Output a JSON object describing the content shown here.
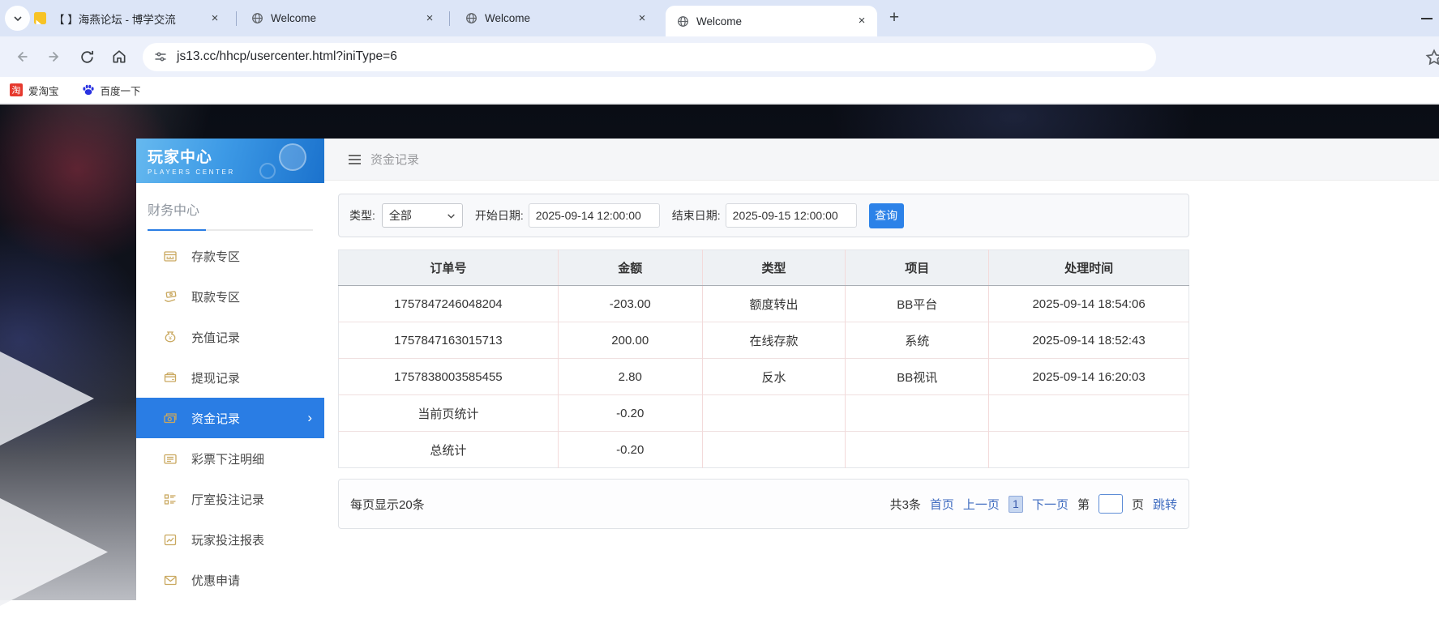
{
  "browser": {
    "tabs": [
      {
        "title": "【 】海燕论坛 - 博学交流",
        "icon": "note-icon",
        "active": false
      },
      {
        "title": "Welcome",
        "icon": "globe-icon",
        "active": false
      },
      {
        "title": "Welcome",
        "icon": "globe-icon",
        "active": false
      },
      {
        "title": "Welcome",
        "icon": "globe-icon",
        "active": true
      }
    ],
    "new_tab_label": "+",
    "url": "js13.cc/hhcp/usercenter.html?iniType=6",
    "nav_icons": [
      "back-icon",
      "forward-icon",
      "reload-icon",
      "home-icon",
      "tune-icon",
      "star-icon"
    ],
    "bookmarks": [
      {
        "label": "爱淘宝",
        "icon": "taobao-icon",
        "icon_glyph": "淘"
      },
      {
        "label": "百度一下",
        "icon": "baidu-paw-icon"
      }
    ]
  },
  "sidebar": {
    "title": "玩家中心",
    "subtitle": "PLAYERS CENTER",
    "section": "财务中心",
    "items": [
      {
        "label": "存款专区",
        "icon": "deposit-icon",
        "active": false
      },
      {
        "label": "取款专区",
        "icon": "withdraw-icon",
        "active": false
      },
      {
        "label": "充值记录",
        "icon": "recharge-icon",
        "active": false
      },
      {
        "label": "提现记录",
        "icon": "cashout-icon",
        "active": false
      },
      {
        "label": "资金记录",
        "icon": "funds-icon",
        "active": true
      },
      {
        "label": "彩票下注明细",
        "icon": "lottery-detail-icon",
        "active": false
      },
      {
        "label": "厅室投注记录",
        "icon": "hall-bet-icon",
        "active": false
      },
      {
        "label": "玩家投注报表",
        "icon": "bet-report-icon",
        "active": false
      },
      {
        "label": "优惠申请",
        "icon": "promo-apply-icon",
        "active": false
      }
    ],
    "active_chevron": "›"
  },
  "main": {
    "page_title": "资金记录",
    "filters": {
      "type_label": "类型:",
      "type_value": "全部",
      "start_label": "开始日期:",
      "start_value": "2025-09-14 12:00:00",
      "end_label": "结束日期:",
      "end_value": "2025-09-15 12:00:00",
      "search_label": "查询"
    },
    "table": {
      "headers": [
        "订单号",
        "金额",
        "类型",
        "项目",
        "处理时间"
      ],
      "rows": [
        [
          "1757847246048204",
          "-203.00",
          "额度转出",
          "BB平台",
          "2025-09-14 18:54:06"
        ],
        [
          "1757847163015713",
          "200.00",
          "在线存款",
          "系统",
          "2025-09-14 18:52:43"
        ],
        [
          "1757838003585455",
          "2.80",
          "反水",
          "BB视讯",
          "2025-09-14 16:20:03"
        ],
        [
          "当前页统计",
          "-0.20",
          "",
          "",
          ""
        ],
        [
          "总统计",
          "-0.20",
          "",
          "",
          ""
        ]
      ]
    },
    "pagination": {
      "per_page": "每页显示20条",
      "total": "共3条",
      "first": "首页",
      "prev": "上一页",
      "current": "1",
      "next": "下一页",
      "jump_prefix": "第",
      "jump_suffix": "页",
      "jump_action": "跳转"
    }
  },
  "colors": {
    "accent_blue": "#2a7de4",
    "button_blue": "#2c82e8",
    "link_blue": "#3f6cc0",
    "gold_icon": "#c9a85f",
    "tab_strip_bg": "#dce5f7",
    "navbar_bg": "#edf1fb"
  }
}
